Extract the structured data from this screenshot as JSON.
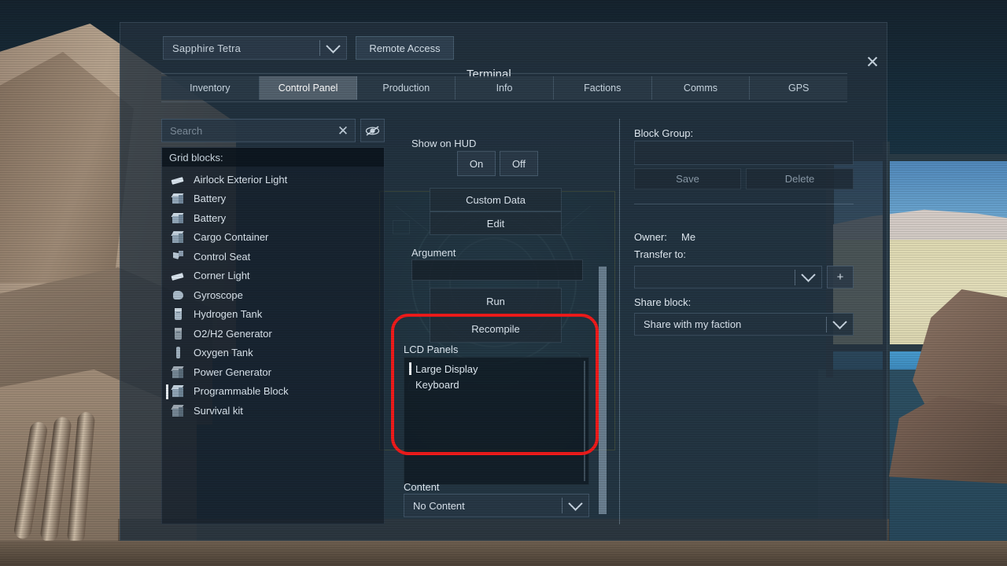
{
  "header": {
    "ship_name": "Sapphire Tetra",
    "remote_access_label": "Remote Access",
    "terminal_title": "Terminal",
    "close_icon": "close-icon"
  },
  "tabs": [
    {
      "label": "Inventory",
      "active": false
    },
    {
      "label": "Control Panel",
      "active": true
    },
    {
      "label": "Production",
      "active": false
    },
    {
      "label": "Info",
      "active": false
    },
    {
      "label": "Factions",
      "active": false
    },
    {
      "label": "Comms",
      "active": false
    },
    {
      "label": "GPS",
      "active": false
    }
  ],
  "left": {
    "search_placeholder": "Search",
    "clear_icon": "close-icon",
    "visibility_icon": "eye-slash-icon",
    "list_header": "Grid blocks:",
    "blocks": [
      {
        "label": "Airlock Exterior Light",
        "icon": "light-icon",
        "selected": false
      },
      {
        "label": "Battery",
        "icon": "battery-icon",
        "selected": false
      },
      {
        "label": "Battery",
        "icon": "battery-icon",
        "selected": false
      },
      {
        "label": "Cargo Container",
        "icon": "cube-icon",
        "selected": false
      },
      {
        "label": "Control Seat",
        "icon": "seat-icon",
        "selected": false
      },
      {
        "label": "Corner Light",
        "icon": "light-icon",
        "selected": false
      },
      {
        "label": "Gyroscope",
        "icon": "gyro-icon",
        "selected": false
      },
      {
        "label": "Hydrogen Tank",
        "icon": "tank-icon",
        "selected": false
      },
      {
        "label": "O2/H2 Generator",
        "icon": "tank-icon",
        "selected": false
      },
      {
        "label": "Oxygen Tank",
        "icon": "thin-tank-icon",
        "selected": false
      },
      {
        "label": "Power Generator",
        "icon": "cube-icon",
        "selected": false
      },
      {
        "label": "Programmable Block",
        "icon": "cube-icon",
        "selected": true
      },
      {
        "label": "Survival kit",
        "icon": "cube-icon",
        "selected": false
      }
    ]
  },
  "center": {
    "show_on_hud_label": "Show on HUD",
    "hud_on_label": "On",
    "hud_off_label": "Off",
    "custom_data_label": "Custom Data",
    "edit_label": "Edit",
    "argument_label": "Argument",
    "argument_value": "",
    "run_label": "Run",
    "recompile_label": "Recompile",
    "lcd_panels_label": "LCD Panels",
    "lcd_panels": [
      {
        "label": "Large Display",
        "selected": true
      },
      {
        "label": "Keyboard",
        "selected": false
      }
    ],
    "content_label": "Content",
    "content_value": "No Content",
    "content_dropdown_icon": "chevron-down-icon"
  },
  "right": {
    "block_group_label": "Block Group:",
    "block_group_value": "",
    "save_label": "Save",
    "delete_label": "Delete",
    "owner_label": "Owner:",
    "owner_value": "Me",
    "transfer_to_label": "Transfer to:",
    "transfer_to_value": "",
    "transfer_add_label": "+",
    "share_block_label": "Share block:",
    "share_block_value": "Share with my faction",
    "dropdown_icon": "chevron-down-icon"
  },
  "annotation": {
    "color": "#f01b1b",
    "shape": "rounded-rectangle"
  },
  "colors": {
    "dialog_bg": "#243240",
    "tab_active": "#566471",
    "text_primary": "#dbe5ee",
    "text_muted": "#8d9dab",
    "annotation_red": "#f01b1b"
  }
}
